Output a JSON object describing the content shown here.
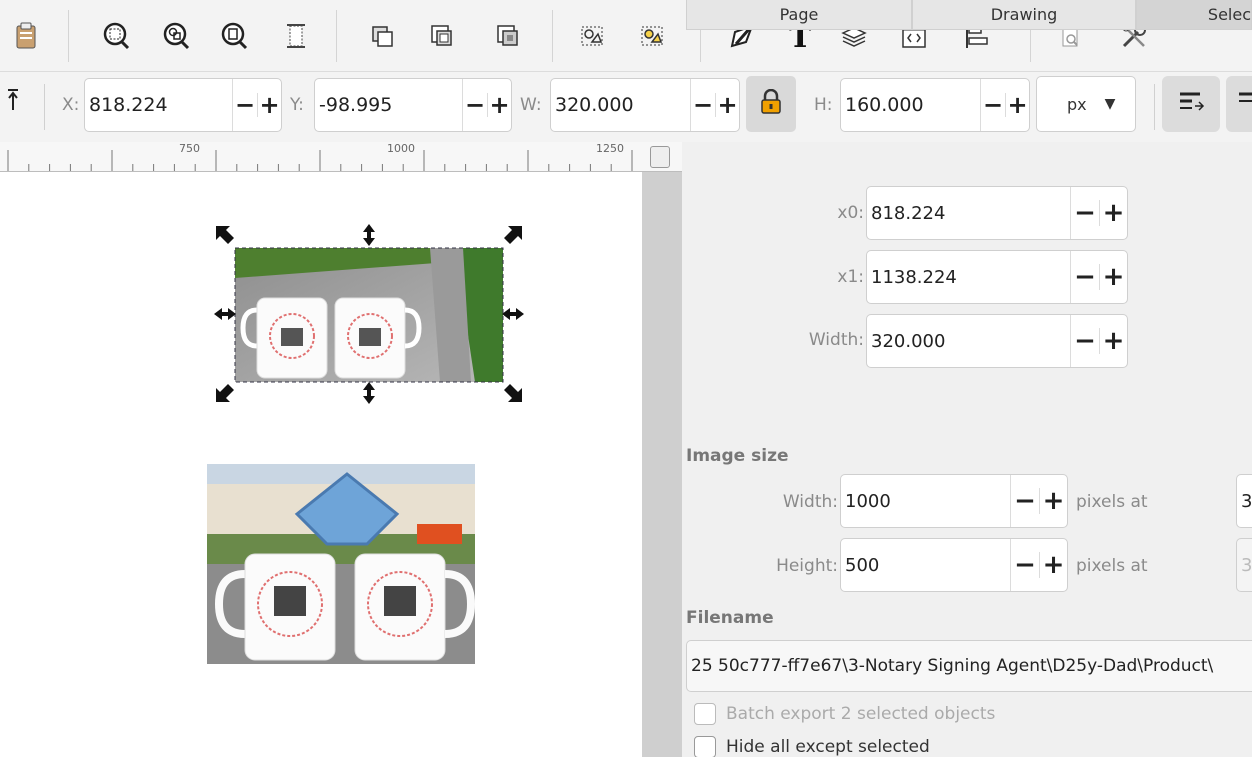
{
  "toolbar2": {
    "x_label": "X:",
    "x_value": "818.224",
    "y_label": "Y:",
    "y_value": "-98.995",
    "w_label": "W:",
    "w_value": "320.000",
    "h_label": "H:",
    "h_value": "160.000",
    "unit": "px",
    "minus": "−",
    "plus": "+"
  },
  "ruler": {
    "labels": [
      "750",
      "1000",
      "1250"
    ]
  },
  "tabs": [
    "Page",
    "Drawing",
    "Selec"
  ],
  "area": {
    "x0_label": "x0:",
    "x0_value": "818.224",
    "x1_label": "x1:",
    "x1_value": "1138.224",
    "width_label": "Width:",
    "width_value": "320.000"
  },
  "image_size": {
    "title": "Image size",
    "width_label": "Width:",
    "width_value": "1000",
    "height_label": "Height:",
    "height_value": "500",
    "pixels_at": "pixels at",
    "dpi_value": "3",
    "dpi_value_2": "3"
  },
  "filename": {
    "title": "Filename",
    "value": "25 50c777-ff7e67\\3-Notary Signing Agent\\D25y-Dad\\Product\\"
  },
  "options": {
    "batch_export": "Batch export 2 selected objects",
    "hide_all": "Hide all except selected"
  },
  "colors": {
    "accent_lock": "#f0a000",
    "canvas_bg": "#ffffff",
    "panel_bg": "#f0f0f0"
  }
}
